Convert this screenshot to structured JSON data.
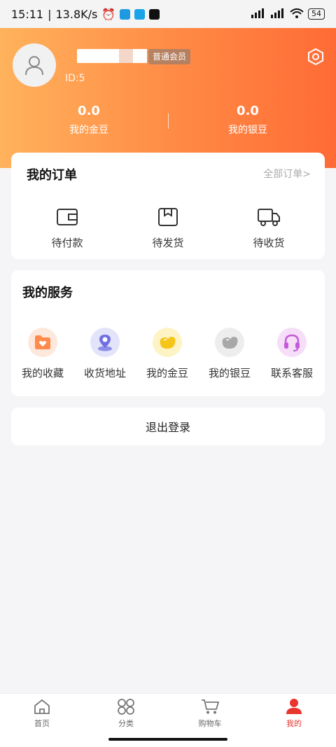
{
  "status_bar": {
    "time": "15:11",
    "net_speed": "13.8K/s",
    "battery": "54"
  },
  "profile": {
    "member_badge": "普通会员",
    "user_id": "ID:5",
    "gold_beans": {
      "value": "0.0",
      "label": "我的金豆"
    },
    "silver_beans": {
      "value": "0.0",
      "label": "我的银豆"
    }
  },
  "orders": {
    "title": "我的订单",
    "all_link": "全部订单>",
    "items": [
      {
        "label": "待付款",
        "icon": "wallet-icon"
      },
      {
        "label": "待发货",
        "icon": "package-icon"
      },
      {
        "label": "待收货",
        "icon": "truck-icon"
      }
    ]
  },
  "services": {
    "title": "我的服务",
    "items": [
      {
        "label": "我的收藏",
        "icon": "favorite-folder-icon",
        "color": "#ff8a4c"
      },
      {
        "label": "收货地址",
        "icon": "location-pin-icon",
        "color": "#6e6fe0"
      },
      {
        "label": "我的金豆",
        "icon": "gold-bean-icon",
        "color": "#f5c518"
      },
      {
        "label": "我的银豆",
        "icon": "silver-bean-icon",
        "color": "#9a9a9a"
      },
      {
        "label": "联系客服",
        "icon": "headset-icon",
        "color": "#c45bd8"
      }
    ]
  },
  "logout": {
    "label": "退出登录"
  },
  "tabbar": {
    "items": [
      {
        "label": "首页",
        "icon": "home-icon"
      },
      {
        "label": "分类",
        "icon": "category-icon"
      },
      {
        "label": "购物车",
        "icon": "cart-icon"
      },
      {
        "label": "我的",
        "icon": "user-icon",
        "active": true
      }
    ]
  },
  "colors": {
    "header_gradient_start": "#ffb25c",
    "header_gradient_end": "#ff6b35",
    "active_tab": "#e8362e"
  }
}
